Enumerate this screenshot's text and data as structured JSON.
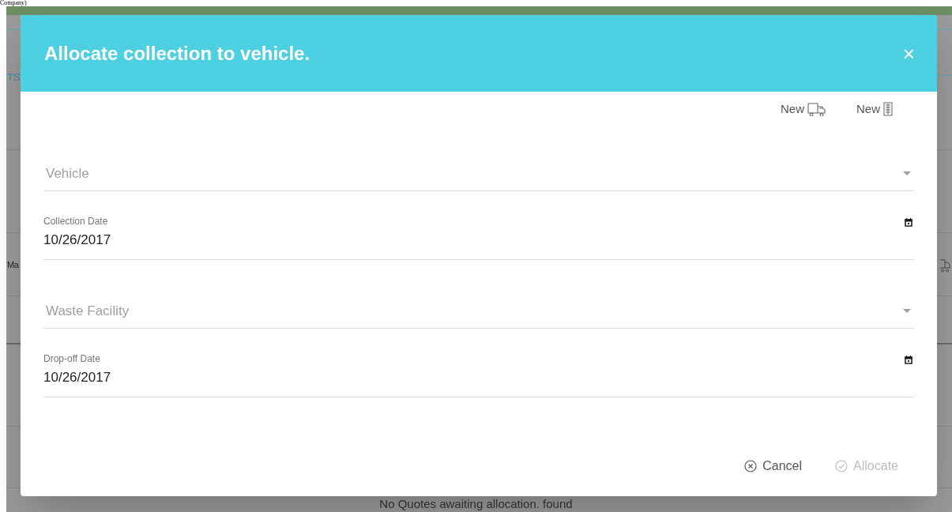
{
  "page_heading": "Company)",
  "background": {
    "tab_label": "TS",
    "row_label": "Ma",
    "empty_message": "No Quotes awaiting allocation. found"
  },
  "dialog": {
    "title": "Allocate collection to vehicle.",
    "close": "×",
    "new_links": [
      {
        "label": "New",
        "kind": "vehicle"
      },
      {
        "label": "New",
        "kind": "facility"
      }
    ],
    "fields": [
      {
        "kind": "select",
        "placeholder": "Vehicle"
      },
      {
        "kind": "date",
        "label": "Collection Date",
        "value": "10/26/2017"
      },
      {
        "kind": "select",
        "placeholder": "Waste Facility"
      },
      {
        "kind": "date",
        "label": "Drop-off Date",
        "value": "10/26/2017"
      }
    ],
    "actions": [
      {
        "label": "Cancel",
        "kind": "cancel",
        "disabled": false
      },
      {
        "label": "Allocate",
        "kind": "confirm",
        "disabled": true
      }
    ]
  }
}
